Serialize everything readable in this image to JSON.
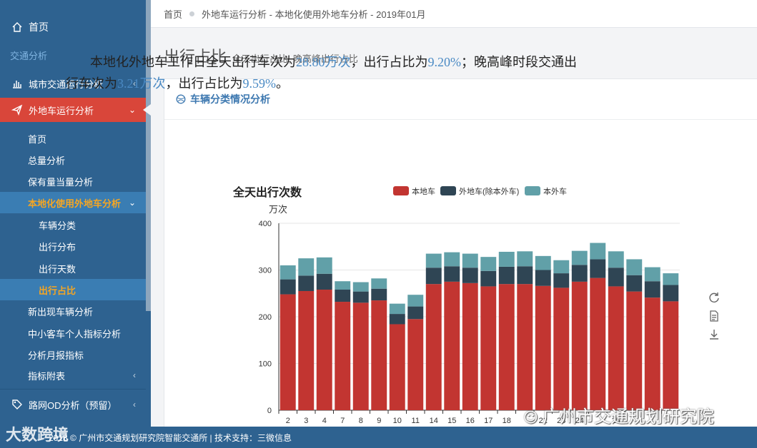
{
  "sidebar": {
    "home": "首页",
    "section": "交通分析",
    "city": "城市交通运行分析",
    "nonlocal": "外地车运行分析",
    "sub": [
      "首页",
      "总量分析",
      "保有量当量分析",
      "本地化使用外地车分析"
    ],
    "sub2": [
      "车辆分类",
      "出行分布",
      "出行天数",
      "出行占比"
    ],
    "more": [
      "新出现车辆分析",
      "中小客车个人指标分析",
      "分析月报指标",
      "指标附表"
    ],
    "od": "路网OD分析（预留）"
  },
  "breadcrumb": {
    "home": "首页",
    "path": "外地车运行分析 - 本地化使用外地车分析 - 2019年01月"
  },
  "page": {
    "title": "出行占比",
    "subtitle": "全天出行占比, 晚高峰出行占比"
  },
  "panel": {
    "title": "车辆分类情况分析",
    "s1": "本地化外地车工作日全天出行车次为",
    "v1": "28.80万次",
    "s2": "，出行占比为",
    "v2": "9.20%",
    "s3": "；晚高峰时段交通出行车次为",
    "v3": "3.21万次",
    "s4": "，出行占比为",
    "v4": "9.59%",
    "s5": "。"
  },
  "footer": {
    "text": "2018 © 广州市交通规划研究院智能交通所 | 技术支持：三微信息"
  },
  "watermark": {
    "left": "大数跨境",
    "right": "广州市交通规划研究院"
  },
  "colors": {
    "local": "#c23531",
    "nonlocal": "#2f4554",
    "outside": "#61a0a8",
    "sidebar": "#2e6290",
    "active": "#d9463a"
  },
  "chart_data": {
    "type": "bar",
    "stacked": true,
    "title": "全天出行次数",
    "ylabel": "万次",
    "ylim": [
      0,
      400
    ],
    "yticks": [
      0,
      100,
      200,
      300,
      400
    ],
    "legend_position": "top",
    "categories": [
      "2",
      "3",
      "4",
      "7",
      "8",
      "9",
      "10",
      "11",
      "14",
      "15",
      "16",
      "17",
      "18",
      "21",
      "22",
      "23",
      "24",
      "25",
      "28",
      "29",
      "30",
      "31"
    ],
    "x_tick_labels": [
      "2",
      "3",
      "4",
      "7",
      "8",
      "9",
      "10",
      "11",
      "14",
      "15",
      "16",
      "17",
      "18",
      "",
      "22",
      "23",
      "24",
      "",
      "25",
      "",
      "",
      ""
    ],
    "series": [
      {
        "name": "本地车",
        "values": [
          248,
          255,
          258,
          232,
          230,
          235,
          184,
          195,
          270,
          275,
          272,
          265,
          270,
          270,
          266,
          262,
          275,
          283,
          265,
          254,
          241,
          233
        ]
      },
      {
        "name": "外地车(除本外车)",
        "values": [
          32,
          33,
          34,
          26,
          24,
          25,
          22,
          27,
          35,
          33,
          33,
          33,
          37,
          38,
          34,
          31,
          36,
          40,
          40,
          35,
          35,
          35
        ]
      },
      {
        "name": "本外车",
        "values": [
          30,
          37,
          35,
          18,
          20,
          22,
          22,
          25,
          30,
          30,
          30,
          30,
          32,
          32,
          30,
          28,
          30,
          35,
          35,
          34,
          30,
          25
        ]
      }
    ]
  }
}
